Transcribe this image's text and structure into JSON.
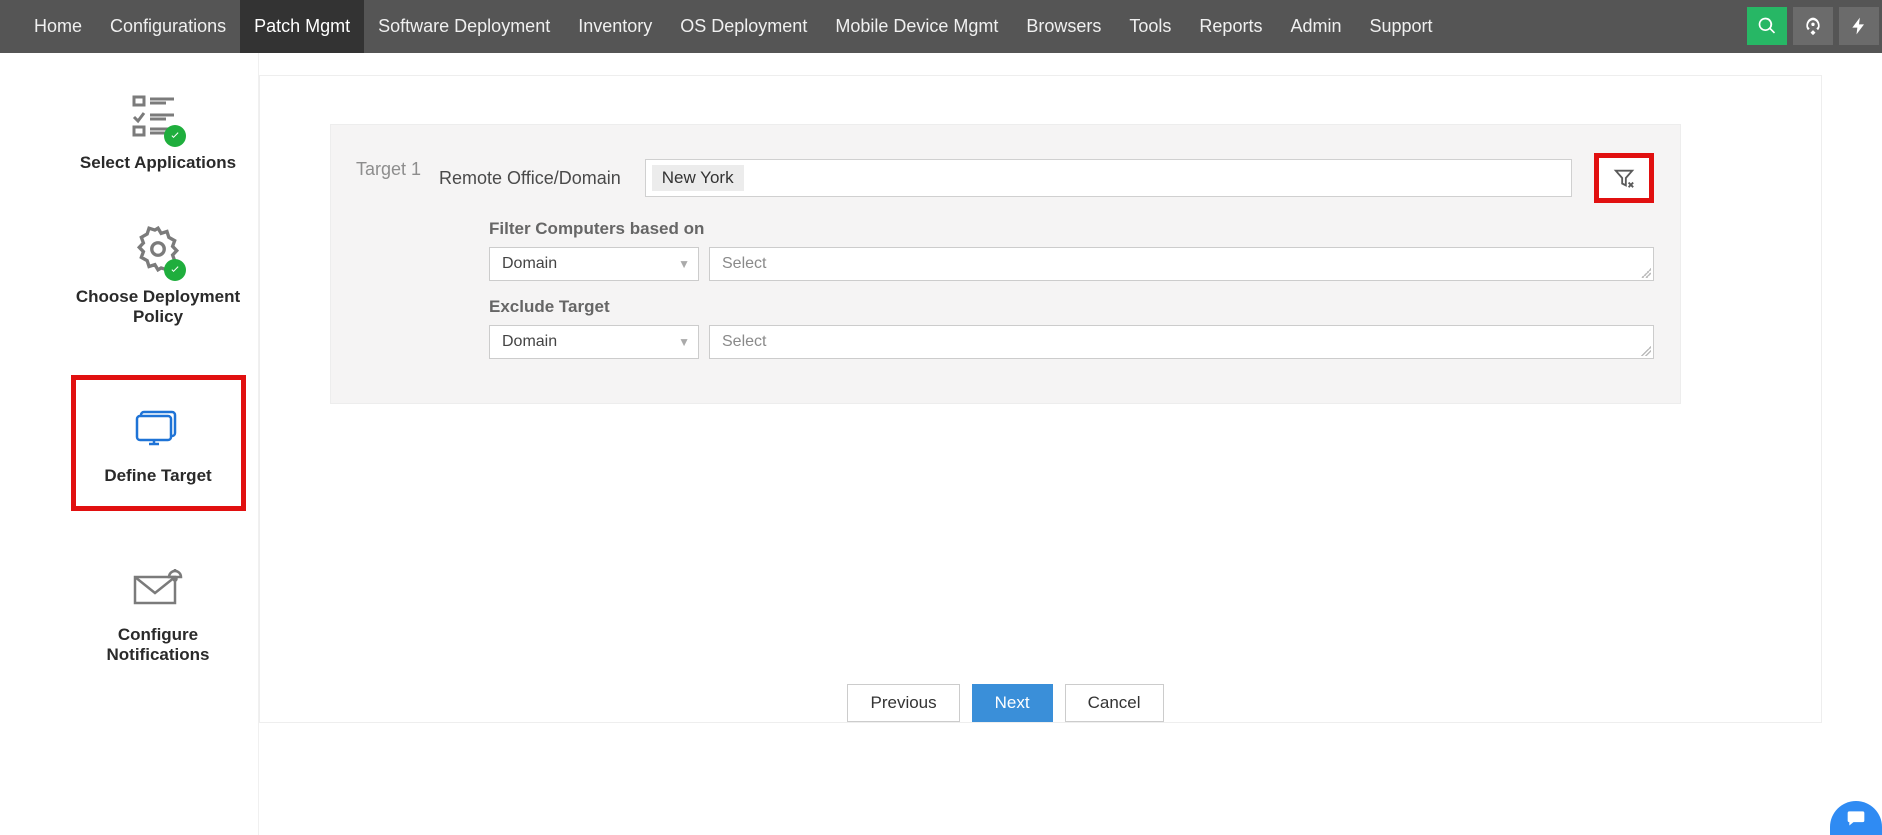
{
  "nav": {
    "items": [
      {
        "label": "Home",
        "active": false
      },
      {
        "label": "Configurations",
        "active": false
      },
      {
        "label": "Patch Mgmt",
        "active": true
      },
      {
        "label": "Software Deployment",
        "active": false
      },
      {
        "label": "Inventory",
        "active": false
      },
      {
        "label": "OS Deployment",
        "active": false
      },
      {
        "label": "Mobile Device Mgmt",
        "active": false
      },
      {
        "label": "Browsers",
        "active": false
      },
      {
        "label": "Tools",
        "active": false
      },
      {
        "label": "Reports",
        "active": false
      },
      {
        "label": "Admin",
        "active": false
      },
      {
        "label": "Support",
        "active": false
      }
    ]
  },
  "steps": {
    "select_apps": "Select Applications",
    "deploy_policy": "Choose Deployment Policy",
    "define_target": "Define Target",
    "notifications": "Configure Notifications"
  },
  "target": {
    "label": "Target 1",
    "remote_office_label": "Remote Office/Domain",
    "chip": "New York",
    "filter_title": "Filter Computers based on",
    "filter_dd": "Domain",
    "filter_placeholder": "Select",
    "exclude_title": "Exclude Target",
    "exclude_dd": "Domain",
    "exclude_placeholder": "Select"
  },
  "footer": {
    "previous": "Previous",
    "next": "Next",
    "cancel": "Cancel"
  }
}
